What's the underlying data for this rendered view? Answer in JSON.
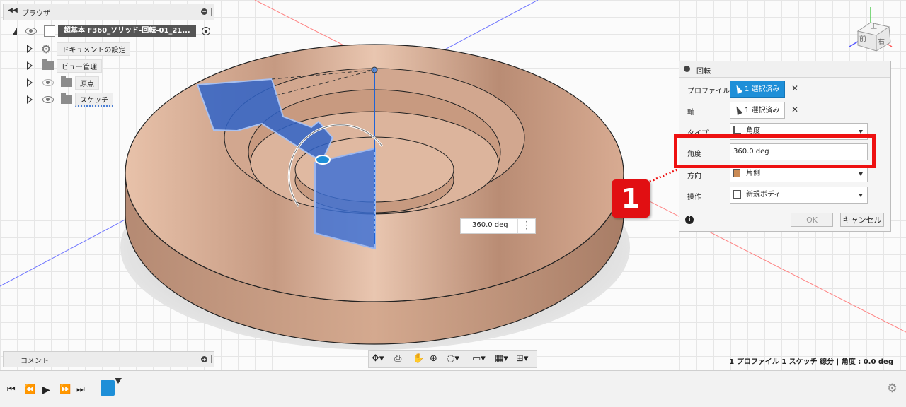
{
  "browser": {
    "title": "ブラウザ",
    "root": "超基本 F360_ソリッド-回転-01_21...",
    "items": [
      {
        "label": "ドキュメントの設定",
        "icon": "gear-icon"
      },
      {
        "label": "ビュー管理",
        "icon": "folder-icon"
      },
      {
        "label": "原点",
        "icon": "folder-icon"
      },
      {
        "label": "スケッチ",
        "icon": "folder-icon"
      }
    ]
  },
  "comment": {
    "title": "コメント"
  },
  "dialog": {
    "title": "回転",
    "rows": {
      "profile": {
        "label": "プロファイル",
        "value": "1 選択済み"
      },
      "axis": {
        "label": "軸",
        "value": "1 選択済み"
      },
      "type": {
        "label": "タイプ",
        "value": "角度"
      },
      "angle": {
        "label": "角度",
        "value": "360.0 deg"
      },
      "direction": {
        "label": "方向",
        "value": "片側"
      },
      "operation": {
        "label": "操作",
        "value": "新規ボディ"
      }
    },
    "ok": "OK",
    "cancel": "キャンセル"
  },
  "canvas": {
    "angle_input": "360.0 deg",
    "callout_number": "1",
    "viewcube_front": "前",
    "viewcube_right": "右",
    "viewcube_top": "上"
  },
  "status": "1 プロファイル 1 スケッチ 線分 | 角度 : 0.0 deg",
  "colors": {
    "accent": "#1e8fd8",
    "highlight": "#e11111",
    "body": "#d9a98c",
    "sketch_blue": "#2f63c8"
  }
}
